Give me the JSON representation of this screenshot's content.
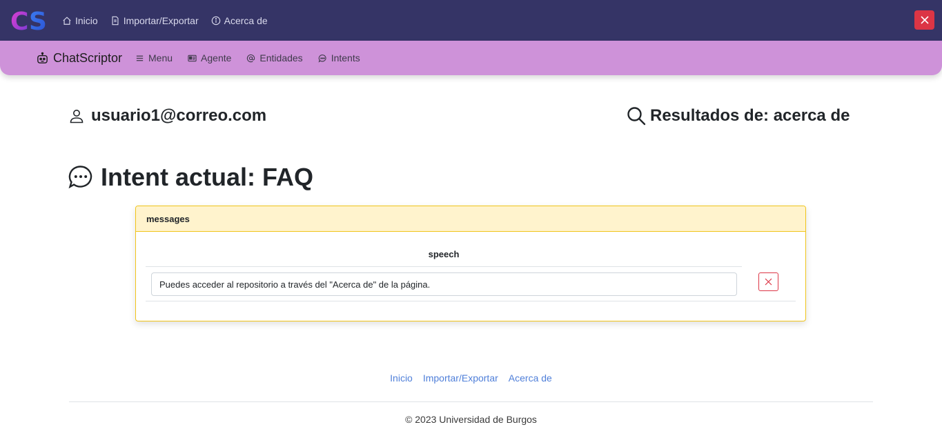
{
  "topbar": {
    "logo_text": "CS",
    "links": [
      {
        "label": "Inicio",
        "icon": "home-icon"
      },
      {
        "label": "Importar/Exportar",
        "icon": "file-icon"
      },
      {
        "label": "Acerca de",
        "icon": "info-icon"
      }
    ],
    "close_icon": "close-icon",
    "colors": {
      "background": "#353466",
      "close": "#dc3545"
    }
  },
  "subbar": {
    "brand": "ChatScriptor",
    "links": [
      {
        "label": "Menu",
        "icon": "menu-icon"
      },
      {
        "label": "Agente",
        "icon": "id-card-icon"
      },
      {
        "label": "Entidades",
        "icon": "at-icon"
      },
      {
        "label": "Intents",
        "icon": "chat-icon"
      }
    ],
    "colors": {
      "background": "#ce92d9"
    }
  },
  "header": {
    "user": "usuario1@correo.com",
    "results": "Resultados de: acerca de"
  },
  "intent": {
    "title": "Intent actual: FAQ"
  },
  "card": {
    "header": "messages",
    "column": "speech",
    "speech_value": "Puedes acceder al repositorio a través del \"Acerca de\" de la página.",
    "colors": {
      "border": "#f0c419",
      "header_bg": "#fff3cd"
    }
  },
  "footer": {
    "links": [
      "Inicio",
      "Importar/Exportar",
      "Acerca de"
    ],
    "copyright": "© 2023 Universidad de Burgos"
  }
}
